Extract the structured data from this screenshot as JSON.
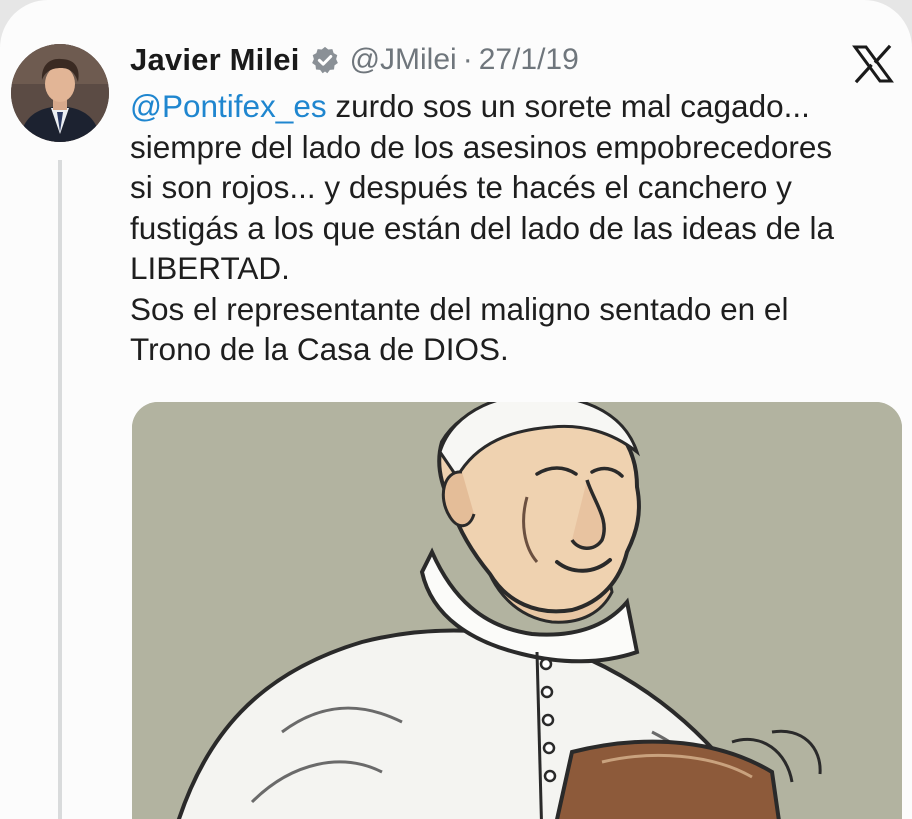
{
  "tweet": {
    "author_name": "Javier Milei",
    "verified_icon": "verified-badge-icon",
    "handle": "@JMilei",
    "separator": "·",
    "date": "27/1/19",
    "platform_icon": "x-logo-icon",
    "mention": "@Pontifex_es",
    "lines": [
      " zurdo sos un sorete mal cagado...",
      "siempre del lado de los asesinos empobrecedores",
      "si son rojos... y después te hacés el canchero y",
      "fustigás a los que están del lado de las ideas de la",
      "LIBERTAD.",
      "Sos el representante del maligno sentado en el",
      "Trono de la Casa de DIOS."
    ]
  },
  "colors": {
    "mention": "#1f86cf",
    "verified_badge": "#8a9096",
    "muted_text": "#6f767c",
    "media_background": "#b2b3a0"
  }
}
